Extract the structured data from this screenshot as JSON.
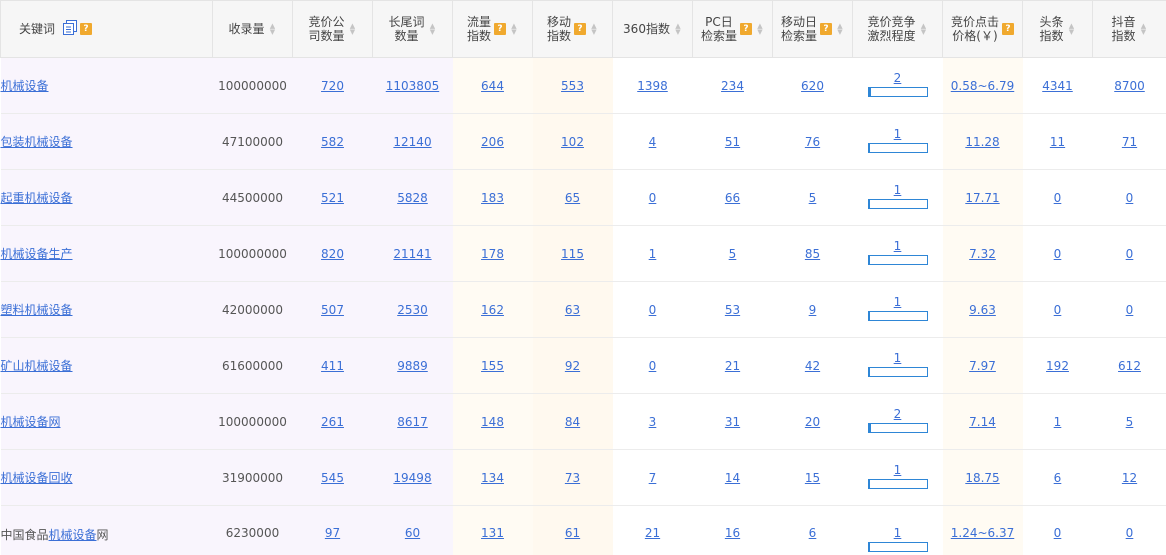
{
  "header": {
    "keyword": "关键词",
    "included": "收录量",
    "bid_companies": [
      "竞价公",
      "司数量"
    ],
    "long_tail": [
      "长尾词",
      "数量"
    ],
    "traffic": [
      "流量",
      "指数"
    ],
    "mobile": [
      "移动",
      "指数"
    ],
    "idx360": "360指数",
    "pc_daily": [
      "PC日",
      "检索量"
    ],
    "mobile_daily": [
      "移动日",
      "检索量"
    ],
    "competition": [
      "竞价竞争",
      "激烈程度"
    ],
    "cpc": [
      "竞价点击",
      "价格(￥)"
    ],
    "toutiao": [
      "头条",
      "指数"
    ],
    "douyin": [
      "抖音",
      "指数"
    ],
    "help_icon": "?"
  },
  "rows": [
    {
      "keyword": "机械设备",
      "included": "100000000",
      "bid": "720",
      "longtail": "1103805",
      "traffic": "644",
      "mobile": "553",
      "i360": "1398",
      "pc": "234",
      "mob": "620",
      "comp": "2",
      "comp_level": 0.04,
      "cpc": "0.58~6.79",
      "toutiao": "4341",
      "douyin": "8700"
    },
    {
      "keyword": "包装机械设备",
      "included": "47100000",
      "bid": "582",
      "longtail": "12140",
      "traffic": "206",
      "mobile": "102",
      "i360": "4",
      "pc": "51",
      "mob": "76",
      "comp": "1",
      "comp_level": 0.02,
      "cpc": "11.28",
      "toutiao": "11",
      "douyin": "71"
    },
    {
      "keyword": "起重机械设备",
      "included": "44500000",
      "bid": "521",
      "longtail": "5828",
      "traffic": "183",
      "mobile": "65",
      "i360": "0",
      "pc": "66",
      "mob": "5",
      "comp": "1",
      "comp_level": 0.02,
      "cpc": "17.71",
      "toutiao": "0",
      "douyin": "0"
    },
    {
      "keyword": "机械设备生产",
      "included": "100000000",
      "bid": "820",
      "longtail": "21141",
      "traffic": "178",
      "mobile": "115",
      "i360": "1",
      "pc": "5",
      "mob": "85",
      "comp": "1",
      "comp_level": 0.02,
      "cpc": "7.32",
      "toutiao": "0",
      "douyin": "0"
    },
    {
      "keyword": "塑料机械设备",
      "included": "42000000",
      "bid": "507",
      "longtail": "2530",
      "traffic": "162",
      "mobile": "63",
      "i360": "0",
      "pc": "53",
      "mob": "9",
      "comp": "1",
      "comp_level": 0.02,
      "cpc": "9.63",
      "toutiao": "0",
      "douyin": "0"
    },
    {
      "keyword": "矿山机械设备",
      "included": "61600000",
      "bid": "411",
      "longtail": "9889",
      "traffic": "155",
      "mobile": "92",
      "i360": "0",
      "pc": "21",
      "mob": "42",
      "comp": "1",
      "comp_level": 0.02,
      "cpc": "7.97",
      "toutiao": "192",
      "douyin": "612"
    },
    {
      "keyword": "机械设备网",
      "included": "100000000",
      "bid": "261",
      "longtail": "8617",
      "traffic": "148",
      "mobile": "84",
      "i360": "3",
      "pc": "31",
      "mob": "20",
      "comp": "2",
      "comp_level": 0.04,
      "cpc": "7.14",
      "toutiao": "1",
      "douyin": "5"
    },
    {
      "keyword": "机械设备回收",
      "included": "31900000",
      "bid": "545",
      "longtail": "19498",
      "traffic": "134",
      "mobile": "73",
      "i360": "7",
      "pc": "14",
      "mob": "15",
      "comp": "1",
      "comp_level": 0.02,
      "cpc": "18.75",
      "toutiao": "6",
      "douyin": "12"
    },
    {
      "keyword": "中国食品机械设备网",
      "keyword_plain": "中国食品",
      "keyword_link": "机械设备",
      "keyword_rest": "网",
      "included": "6230000",
      "bid": "97",
      "longtail": "60",
      "traffic": "131",
      "mobile": "61",
      "i360": "21",
      "pc": "16",
      "mob": "6",
      "comp": "1",
      "comp_level": 0.02,
      "cpc": "1.24~6.37",
      "toutiao": "0",
      "douyin": "0"
    }
  ]
}
